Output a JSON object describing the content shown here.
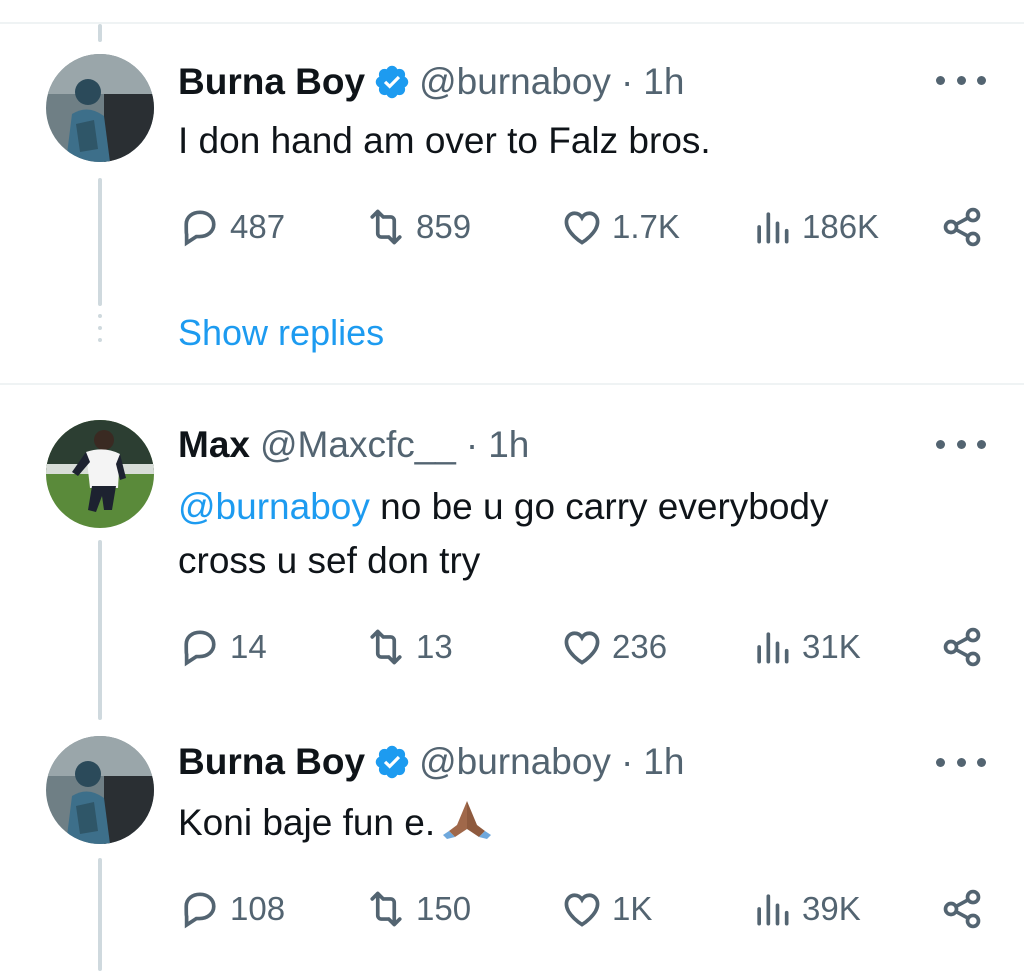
{
  "tweets": [
    {
      "name": "Burna Boy",
      "verified": true,
      "handle": "@burnaboy",
      "separator": "·",
      "time": "1h",
      "text": "I don hand am over to Falz bros.",
      "replies": "487",
      "retweets": "859",
      "likes": "1.7K",
      "views": "186K"
    },
    {
      "name": "Max",
      "verified": false,
      "handle": "@Maxcfc__",
      "separator": "·",
      "time": "1h",
      "mention": "@burnaboy",
      "text_line1": " no be u go carry everybody",
      "text_line2": "cross u sef don try",
      "replies": "14",
      "retweets": "13",
      "likes": "236",
      "views": "31K"
    },
    {
      "name": "Burna Boy",
      "verified": true,
      "handle": "@burnaboy",
      "separator": "·",
      "time": "1h",
      "text": "Koni baje fun e.",
      "emoji": "folded-hands",
      "replies": "108",
      "retweets": "150",
      "likes": "1K",
      "views": "39K"
    }
  ],
  "show_replies_label": "Show replies",
  "colors": {
    "accent": "#1d9bf0",
    "muted": "#536471",
    "text": "#0f1419",
    "line": "#cfd9de"
  },
  "icons": [
    "reply-icon",
    "retweet-icon",
    "like-icon",
    "views-icon",
    "share-icon",
    "verified-badge-icon",
    "more-icon"
  ]
}
